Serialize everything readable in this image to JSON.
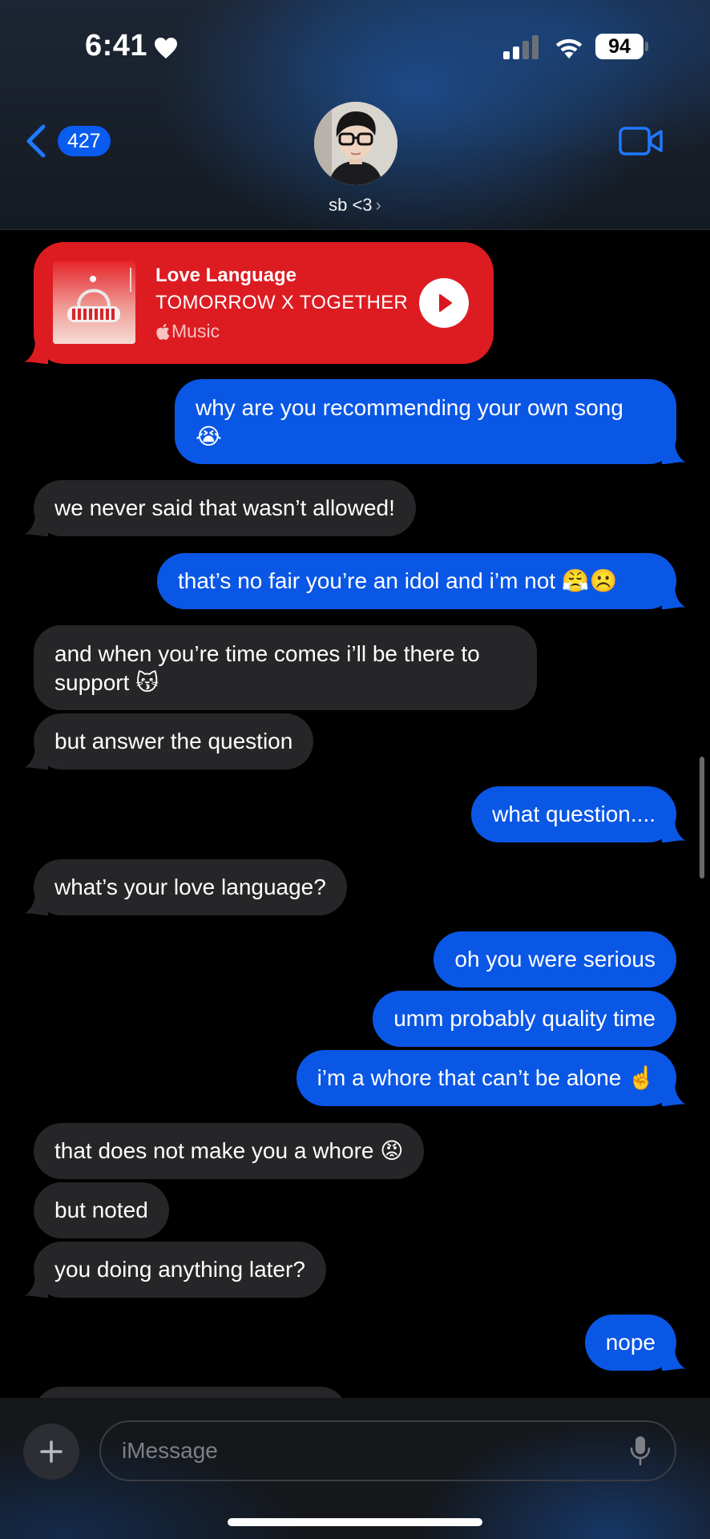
{
  "status_bar": {
    "time": "6:41",
    "battery": "94",
    "icons": [
      "heart-icon",
      "signal-icon",
      "wifi-icon",
      "battery-icon"
    ]
  },
  "header": {
    "back_count": "427",
    "contact_name": "sb <3",
    "contact_chevron": "›",
    "icons": [
      "back-chevron-icon",
      "video-call-icon"
    ]
  },
  "music_card": {
    "title": "Love Language",
    "artist": "TOMORROW X TOGETHER",
    "service": "Music",
    "icons": [
      "apple-icon",
      "play-icon"
    ]
  },
  "messages": [
    {
      "dir": "out",
      "text": "why are you recommending your own song 😭"
    },
    {
      "dir": "in",
      "text": "we never said that wasn’t allowed!"
    },
    {
      "dir": "out",
      "text": "that’s no fair you’re an idol and i’m not 😤☹️"
    },
    {
      "dir": "in",
      "text": "and when you’re time comes i’ll be there to support 😽"
    },
    {
      "dir": "in",
      "text": "but answer the question"
    },
    {
      "dir": "out",
      "text": "what question...."
    },
    {
      "dir": "in",
      "text": "what’s your love language?"
    },
    {
      "dir": "out",
      "text": "oh you were serious"
    },
    {
      "dir": "out",
      "text": "umm probably quality time"
    },
    {
      "dir": "out",
      "text": "i’m a whore that can’t be alone ☝️"
    },
    {
      "dir": "in",
      "text": "that does not make you a whore 😡"
    },
    {
      "dir": "in",
      "text": "but noted"
    },
    {
      "dir": "in",
      "text": "you doing anything later?"
    },
    {
      "dir": "out",
      "text": "nope"
    }
  ],
  "input": {
    "placeholder": "iMessage",
    "icons": [
      "plus-icon",
      "microphone-icon"
    ]
  },
  "colors": {
    "outgoing_bubble": "#0a57e6",
    "incoming_bubble": "#262628",
    "music_card": "#dd1c22",
    "accent": "#0a5cf0"
  }
}
